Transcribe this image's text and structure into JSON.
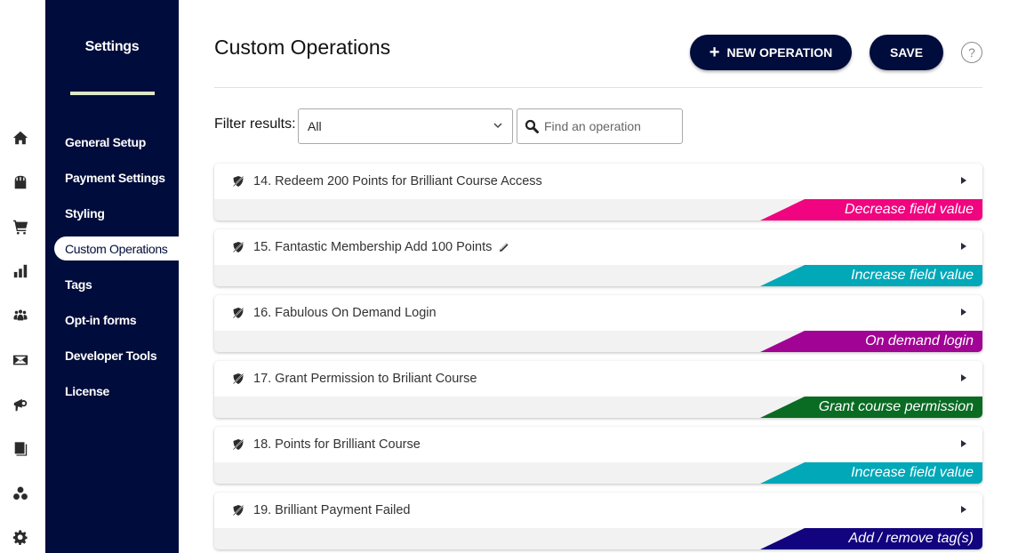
{
  "rail": {
    "icons": [
      {
        "name": "home-icon"
      },
      {
        "name": "store-icon"
      },
      {
        "name": "cart-icon"
      },
      {
        "name": "bar-chart-icon"
      },
      {
        "name": "users-icon"
      },
      {
        "name": "envelope-icon"
      },
      {
        "name": "megaphone-icon"
      },
      {
        "name": "book-icon"
      },
      {
        "name": "circles-icon"
      },
      {
        "name": "gear-icon"
      }
    ]
  },
  "sidebar": {
    "title": "Settings",
    "items": [
      {
        "label": "General Setup",
        "active": false
      },
      {
        "label": "Payment Settings",
        "active": false
      },
      {
        "label": "Styling",
        "active": false
      },
      {
        "label": "Custom Operations",
        "active": true
      },
      {
        "label": "Tags",
        "active": false
      },
      {
        "label": "Opt-in forms",
        "active": false
      },
      {
        "label": "Developer Tools",
        "active": false
      },
      {
        "label": "License",
        "active": false
      }
    ]
  },
  "header": {
    "title": "Custom Operations",
    "new_button": "NEW OPERATION",
    "save_button": "SAVE",
    "help": "?"
  },
  "filter": {
    "label": "Filter results:",
    "selected": "All",
    "search_placeholder": "Find an operation",
    "search_value": ""
  },
  "operations": [
    {
      "title": "14. Redeem 200 Points for Brilliant Course Access",
      "type": "Decrease field value",
      "color": "#f0047f",
      "editing": false
    },
    {
      "title": "15. Fantastic Membership Add 100 Points",
      "type": "Increase field value",
      "color": "#00a8b8",
      "editing": true
    },
    {
      "title": "16. Fabulous On Demand Login",
      "type": "On demand login",
      "color": "#a10394",
      "editing": false
    },
    {
      "title": "17. Grant Permission to Briliant Course",
      "type": "Grant course permission",
      "color": "#0a6b23",
      "editing": false
    },
    {
      "title": "18. Points for Brilliant Course",
      "type": "Increase field value",
      "color": "#00a8b8",
      "editing": false
    },
    {
      "title": "19. Brilliant Payment Failed",
      "type": "Add / remove tag(s)",
      "color": "#12037e",
      "editing": false
    }
  ],
  "colors": {
    "brand_dark": "#000c3b",
    "sidebar_rule": "#dbe8c8"
  }
}
